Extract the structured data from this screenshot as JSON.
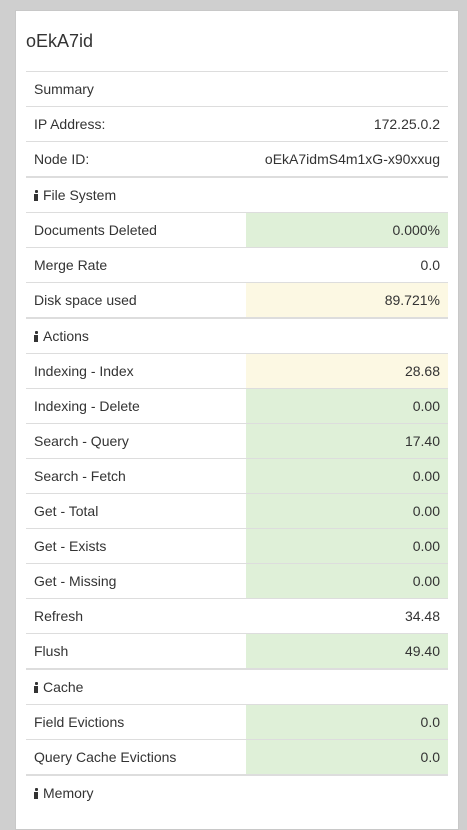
{
  "node": {
    "title": "oEkA7id"
  },
  "summary": {
    "header": "Summary",
    "rows": [
      {
        "label": "IP Address:",
        "value": "172.25.0.2"
      },
      {
        "label": "Node ID:",
        "value": "oEkA7idmS4m1xG-x90xxug"
      }
    ]
  },
  "file_system": {
    "header": "File System",
    "rows": [
      {
        "label": "Documents Deleted",
        "value": "0.000%",
        "status": "good"
      },
      {
        "label": "Merge Rate",
        "value": "0.0",
        "status": "none"
      },
      {
        "label": "Disk space used",
        "value": "89.721%",
        "status": "warn"
      }
    ]
  },
  "actions": {
    "header": "Actions",
    "rows": [
      {
        "label": "Indexing - Index",
        "value": "28.68",
        "status": "warn"
      },
      {
        "label": "Indexing - Delete",
        "value": "0.00",
        "status": "good"
      },
      {
        "label": "Search - Query",
        "value": "17.40",
        "status": "good"
      },
      {
        "label": "Search - Fetch",
        "value": "0.00",
        "status": "good"
      },
      {
        "label": "Get - Total",
        "value": "0.00",
        "status": "good"
      },
      {
        "label": "Get - Exists",
        "value": "0.00",
        "status": "good"
      },
      {
        "label": "Get - Missing",
        "value": "0.00",
        "status": "good"
      },
      {
        "label": "Refresh",
        "value": "34.48",
        "status": "none"
      },
      {
        "label": "Flush",
        "value": "49.40",
        "status": "good"
      }
    ]
  },
  "cache": {
    "header": "Cache",
    "rows": [
      {
        "label": "Field Evictions",
        "value": "0.0",
        "status": "good"
      },
      {
        "label": "Query Cache Evictions",
        "value": "0.0",
        "status": "good"
      }
    ]
  },
  "memory": {
    "header": "Memory"
  },
  "colors": {
    "good_bg": "#dff0d8",
    "warn_bg": "#fcf8e3",
    "page_bg": "#cfcfcf"
  }
}
